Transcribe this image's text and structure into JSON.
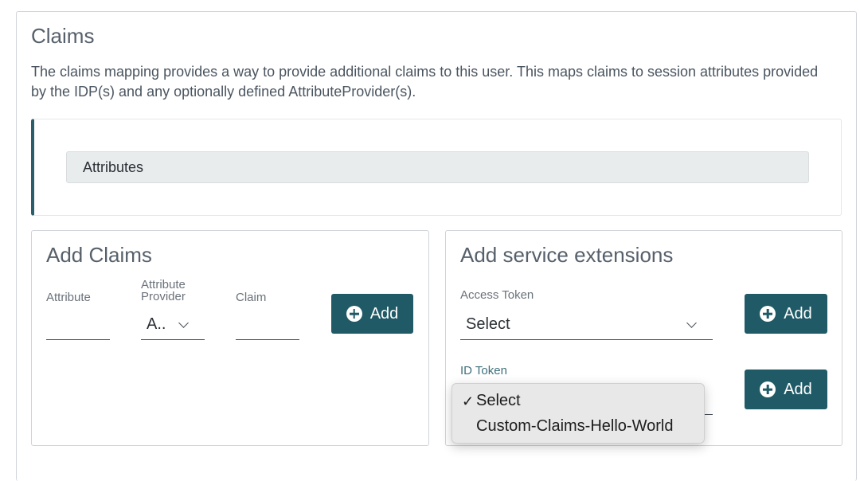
{
  "claims": {
    "title": "Claims",
    "description": "The claims mapping provides a way to provide additional claims to this user. This maps claims to session attributes provided by the IDP(s) and any optionally defined AttributeProvider(s).",
    "attributes_label": "Attributes"
  },
  "add_claims": {
    "title": "Add Claims",
    "attribute_label": "Attribute",
    "attribute_provider_label_1": "Attribute",
    "attribute_provider_label_2": "Provider",
    "attribute_provider_value": "A..",
    "claim_label": "Claim",
    "add_label": "Add"
  },
  "service_extensions": {
    "title": "Add service extensions",
    "access_token_label": "Access Token",
    "access_token_value": "Select",
    "access_add_label": "Add",
    "id_token_label": "ID Token",
    "id_add_label": "Add",
    "dropdown_options": [
      "Select",
      "Custom-Claims-Hello-World"
    ],
    "checkmark": "✓"
  },
  "colors": {
    "accent": "#1f5a66",
    "border": "#cfd4d8",
    "text": "#56606b"
  }
}
